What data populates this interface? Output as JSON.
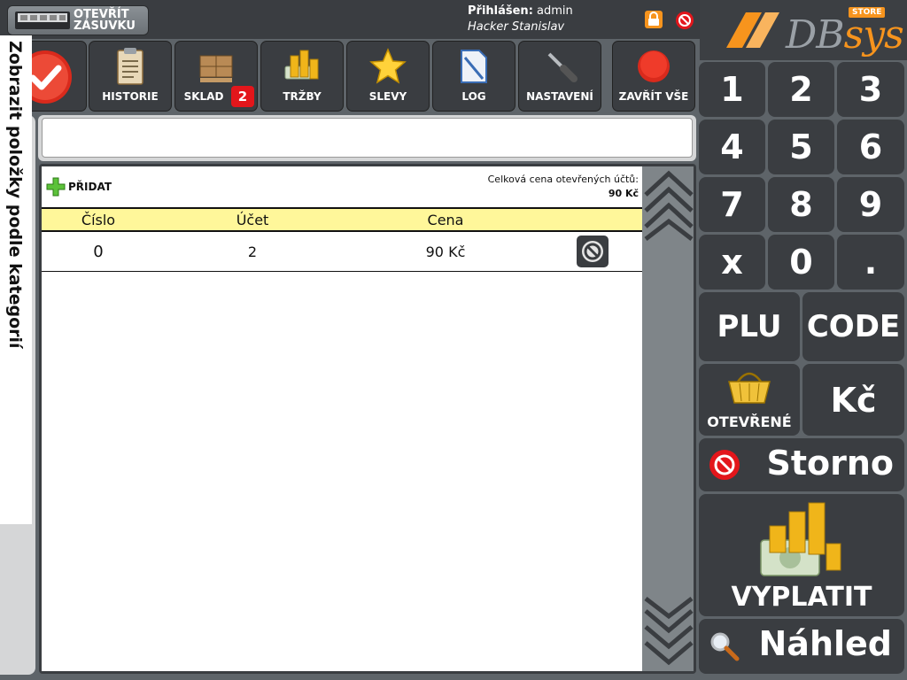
{
  "header": {
    "drawer_button": "OTEVŘÍT ZÁSUVKU",
    "logged_in_label": "Přihlášen:",
    "logged_in_user": "admin",
    "operator_name": "Hacker Stanislav"
  },
  "logo": {
    "text_main": "DB",
    "text_accent": "sys",
    "badge": "STORE"
  },
  "toolbar": {
    "history": "HISTORIE",
    "stock": "SKLAD",
    "stock_badge": "2",
    "sales": "TRŽBY",
    "discounts": "SLEVY",
    "log": "LOG",
    "settings": "NASTAVENÍ",
    "close_all": "ZAVŘÍT VŠE"
  },
  "category_tab": {
    "label": "Zobrazit položky podle kategorií"
  },
  "input": {
    "value": "",
    "placeholder": ""
  },
  "list": {
    "add_label": "PŘIDAT",
    "total_label": "Celková cena otevřených účtů:",
    "total_value": "90 Kč",
    "columns": [
      "Číslo",
      "Účet",
      "Cena"
    ],
    "rows": [
      {
        "number": "0",
        "account": "2",
        "price": "90 Kč"
      }
    ]
  },
  "keypad": {
    "keys": [
      "1",
      "2",
      "3",
      "4",
      "5",
      "6",
      "7",
      "8",
      "9",
      "x",
      "0",
      "."
    ],
    "plu": "PLU",
    "code": "CODE",
    "open_label": "OTEVŘENÉ",
    "currency": "Kč",
    "storno": "Storno",
    "pay": "VYPLATIT",
    "preview": "Náhled"
  },
  "colors": {
    "accent": "#f7941d",
    "panel": "#3a3d41",
    "table_header": "#fff79a",
    "danger": "#e3161b"
  }
}
